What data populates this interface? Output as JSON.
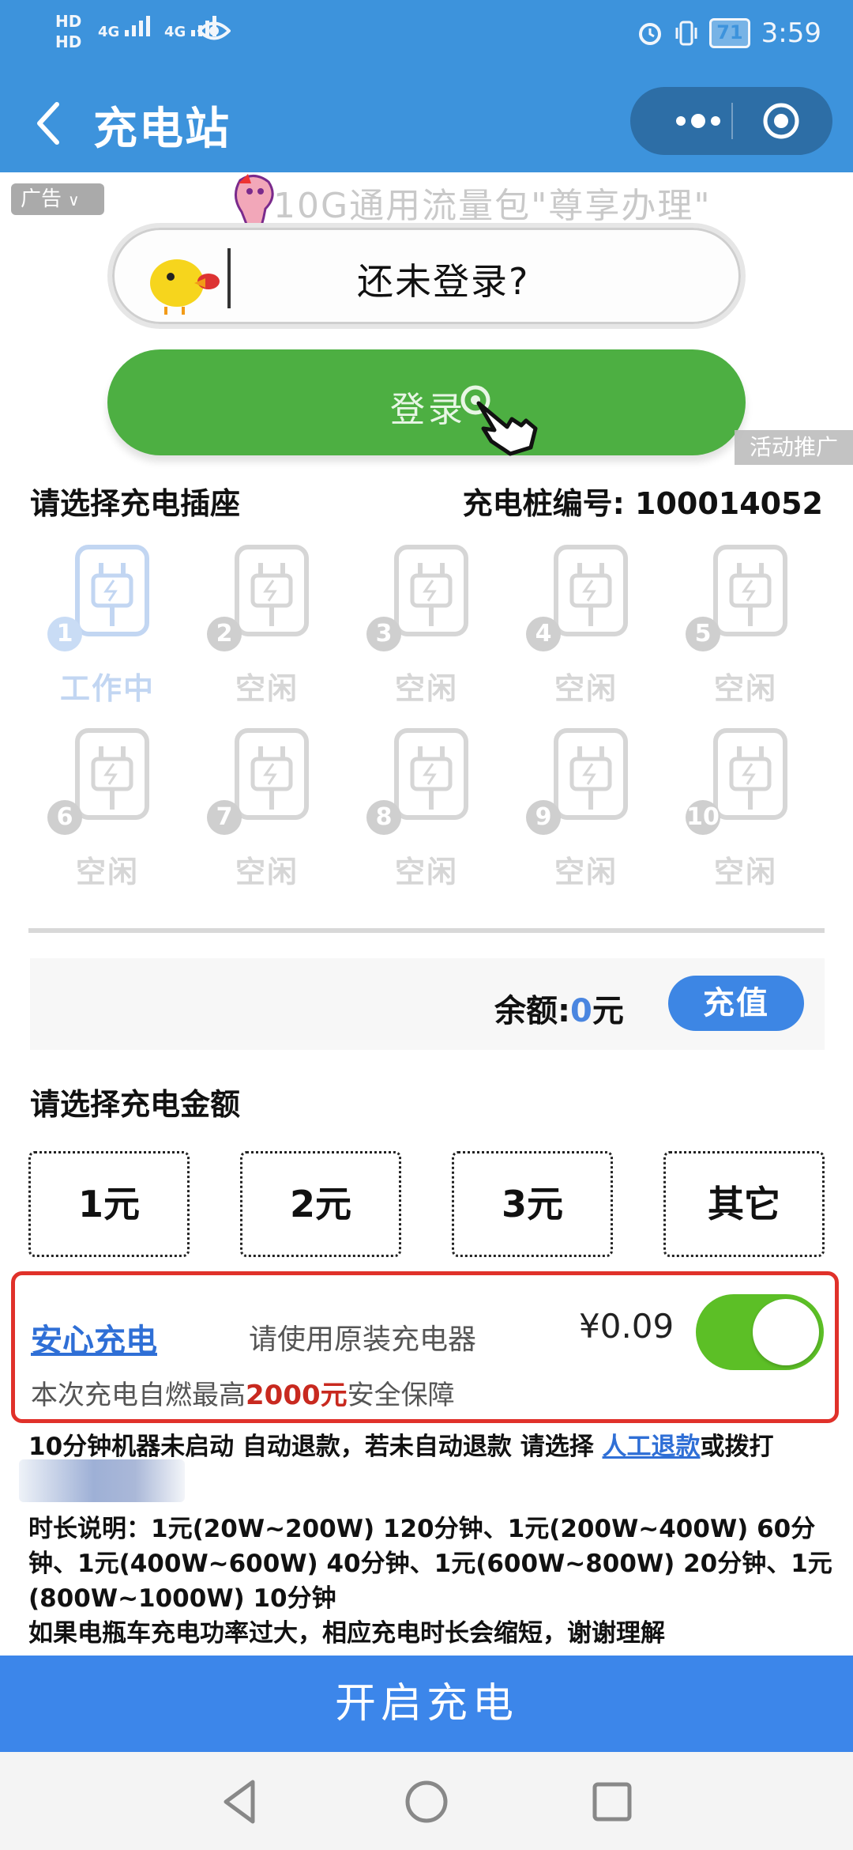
{
  "status_bar": {
    "hd_top": "HD",
    "hd_bottom": "HD",
    "sig1": "4G",
    "sig2": "4G",
    "battery": "71",
    "time": "3:59"
  },
  "header": {
    "title": "充电站",
    "back_icon": "chevron-left-icon",
    "menu_icon": "more-dots-icon",
    "close_icon": "target-circle-icon"
  },
  "ad": {
    "tag": "广告",
    "headline": "10G通用流量包\"尊享办理\"",
    "card_text": "还未登录?",
    "login_label": "登录",
    "promo_tag": "活动推广"
  },
  "sockets": {
    "title": "请选择充电插座",
    "station_code_label": "充电桩编号:",
    "station_code": "100014052",
    "items": [
      {
        "num": "1",
        "status": "工作中"
      },
      {
        "num": "2",
        "status": "空闲"
      },
      {
        "num": "3",
        "status": "空闲"
      },
      {
        "num": "4",
        "status": "空闲"
      },
      {
        "num": "5",
        "status": "空闲"
      },
      {
        "num": "6",
        "status": "空闲"
      },
      {
        "num": "7",
        "status": "空闲"
      },
      {
        "num": "8",
        "status": "空闲"
      },
      {
        "num": "9",
        "status": "空闲"
      },
      {
        "num": "10",
        "status": "空闲"
      }
    ]
  },
  "balance": {
    "label": "余额:",
    "value": "0",
    "unit": "元",
    "recharge": "充值"
  },
  "amount": {
    "title": "请选择充电金额",
    "options": [
      "1元",
      "2元",
      "3元",
      "其它"
    ]
  },
  "safe_charge": {
    "title": "安心充电",
    "hint": "请使用原装充电器",
    "price": "¥0.09",
    "toggle_on": true,
    "desc_prefix": "本次充电自燃最高",
    "desc_amount": "2000元",
    "desc_suffix": "安全保障"
  },
  "notes": {
    "refund_prefix": "10分钟机器未启动 自动退款，若未自动退款 请选择 ",
    "refund_link": "人工退款",
    "refund_suffix": "或拨打",
    "duration_1": "时长说明：1元(20W~200W) 120分钟、1元(200W~400W) 60分",
    "duration_2": "钟、1元(400W~600W) 40分钟、1元(600W~800W) 20分钟、1元",
    "duration_3": "(800W~1000W) 10分钟",
    "power_note": "如果电瓶车充电功率过大，相应充电时长会缩短，谢谢理解"
  },
  "footer": {
    "start_label": "开启充电"
  },
  "colors": {
    "header_blue": "#3d93dc",
    "login_green": "#4daf42",
    "start_blue": "#3c86ea",
    "safe_border_red": "#e0312a",
    "toggle_green": "#5cbf26"
  }
}
